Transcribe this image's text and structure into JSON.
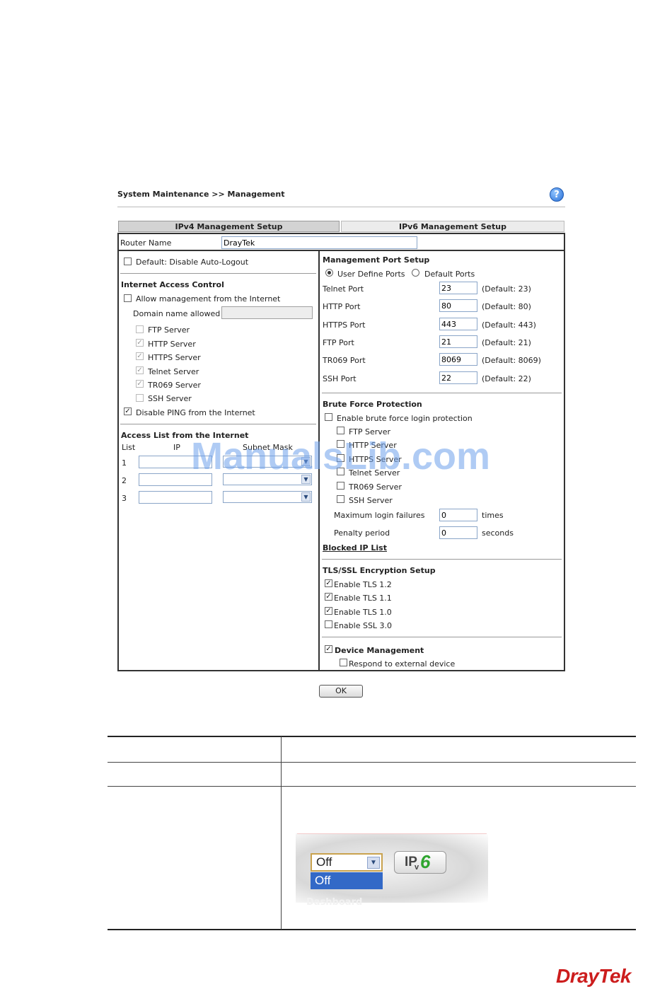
{
  "page": {
    "title": "System Maintenance >> Management",
    "help_icon": "?"
  },
  "tabs": [
    {
      "label": "IPv4 Management Setup",
      "active": true
    },
    {
      "label": "IPv6 Management Setup",
      "active": false
    }
  ],
  "router_name": {
    "label": "Router Name",
    "value": "DrayTek"
  },
  "left": {
    "auto_logout": {
      "label": "Default: Disable Auto-Logout",
      "checked": false
    },
    "iac": {
      "heading": "Internet Access Control",
      "allow_mgmt": {
        "label": "Allow management from the Internet",
        "checked": false
      },
      "domain_label": "Domain name allowed",
      "domain_value": "",
      "servers": [
        {
          "label": "FTP Server",
          "checked": false
        },
        {
          "label": "HTTP Server",
          "checked": true
        },
        {
          "label": "HTTPS Server",
          "checked": true
        },
        {
          "label": "Telnet Server",
          "checked": true
        },
        {
          "label": "TR069 Server",
          "checked": true
        },
        {
          "label": "SSH Server",
          "checked": false
        }
      ],
      "disable_ping": {
        "label": "Disable PING from the Internet",
        "checked": true
      }
    },
    "access_list": {
      "heading": "Access List from the Internet",
      "col_list": "List",
      "col_ip": "IP",
      "col_mask": "Subnet Mask",
      "rows": [
        {
          "num": "1",
          "ip": "",
          "mask": ""
        },
        {
          "num": "2",
          "ip": "",
          "mask": ""
        },
        {
          "num": "3",
          "ip": "",
          "mask": ""
        }
      ]
    }
  },
  "right": {
    "mps": {
      "heading": "Management Port Setup",
      "user_define": "User Define Ports",
      "default_ports": "Default Ports",
      "selected": "user_define",
      "ports": [
        {
          "label": "Telnet Port",
          "value": "23",
          "default": "(Default: 23)"
        },
        {
          "label": "HTTP Port",
          "value": "80",
          "default": "(Default: 80)"
        },
        {
          "label": "HTTPS Port",
          "value": "443",
          "default": "(Default: 443)"
        },
        {
          "label": "FTP Port",
          "value": "21",
          "default": "(Default: 21)"
        },
        {
          "label": "TR069 Port",
          "value": "8069",
          "default": "(Default: 8069)"
        },
        {
          "label": "SSH Port",
          "value": "22",
          "default": "(Default: 22)"
        }
      ]
    },
    "bfp": {
      "heading": "Brute Force Protection",
      "enable": {
        "label": "Enable brute force login protection",
        "checked": false
      },
      "servers": [
        {
          "label": "FTP Server",
          "checked": false
        },
        {
          "label": "HTTP Server",
          "checked": false
        },
        {
          "label": "HTTPS Server",
          "checked": false
        },
        {
          "label": "Telnet Server",
          "checked": false
        },
        {
          "label": "TR069 Server",
          "checked": false
        },
        {
          "label": "SSH Server",
          "checked": false
        }
      ],
      "max_label": "Maximum login failures",
      "max_value": "0",
      "max_unit": "times",
      "penalty_label": "Penalty period",
      "penalty_value": "0",
      "penalty_unit": "seconds",
      "blocked_link": "Blocked IP List"
    },
    "tls": {
      "heading": "TLS/SSL Encryption Setup",
      "items": [
        {
          "label": "Enable TLS 1.2",
          "checked": true
        },
        {
          "label": "Enable TLS 1.1",
          "checked": true
        },
        {
          "label": "Enable TLS 1.0",
          "checked": true
        },
        {
          "label": "Enable SSL 3.0",
          "checked": false
        }
      ]
    },
    "device_mgmt": {
      "label": "Device Management",
      "checked": true,
      "respond": {
        "label": "Respond to external device",
        "checked": false
      }
    }
  },
  "ok_button": "OK",
  "watermark": "ManualsLib.com",
  "screenshot": {
    "select_value": "Off",
    "option_highlight": "Off",
    "faded_text": "Dashboard",
    "ipv6_ip": "IP",
    "ipv6_v": "v",
    "ipv6_6": "6"
  },
  "logo": {
    "part1": "Dray",
    "part2": "Tek"
  }
}
